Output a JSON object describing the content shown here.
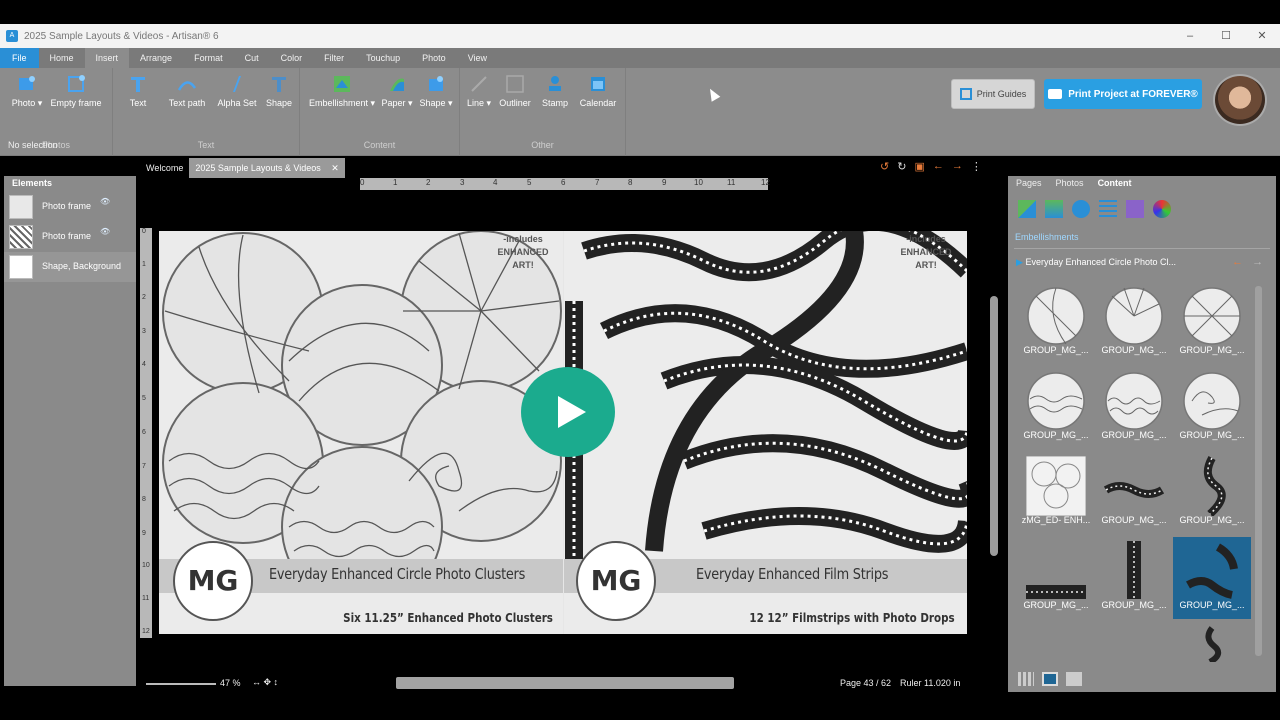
{
  "window": {
    "title": "2025 Sample Layouts & Videos - Artisan® 6",
    "app_icon": "A"
  },
  "menu": [
    "File",
    "Home",
    "Insert",
    "Arrange",
    "Format",
    "Cut",
    "Color",
    "Filter",
    "Touchup",
    "Photo",
    "View"
  ],
  "ribbon": {
    "photos": {
      "label": "Photos",
      "items": [
        "Photo ▾",
        "Empty frame"
      ]
    },
    "text": {
      "label": "Text",
      "items": [
        "Text",
        "Text path",
        "Alpha Set",
        "Shape"
      ]
    },
    "content": {
      "label": "Content",
      "items": [
        "Embellishment ▾",
        "Paper ▾",
        "Shape ▾"
      ]
    },
    "other": {
      "label": "Other",
      "items": [
        "Line ▾",
        "Outliner",
        "Stamp",
        "Calendar"
      ]
    }
  },
  "buttons": {
    "print_guides": "Print Guides",
    "print_project": "Print Project at FOREVER®"
  },
  "selection_status": "No selection",
  "elements_panel": {
    "title": "Elements",
    "items": [
      "Photo frame",
      "Photo frame",
      "Shape, Background"
    ]
  },
  "doc_tabs": {
    "welcome": "Welcome",
    "active": "2025 Sample Layouts & Videos",
    "close": "✕"
  },
  "ruler": {
    "h": [
      "0",
      "1",
      "2",
      "3",
      "4",
      "5",
      "6",
      "7",
      "8",
      "9",
      "10",
      "11",
      "12"
    ],
    "v": [
      "0",
      "1",
      "2",
      "3",
      "4",
      "5",
      "6",
      "7",
      "8",
      "9",
      "10",
      "11",
      "12"
    ]
  },
  "page_content": {
    "left_title": "Everyday Enhanced Circle Photo Clusters",
    "left_sub": "Six 11.25” Enhanced Photo Clusters",
    "right_title": "Everyday Enhanced Film Strips",
    "right_sub": "12 12” Filmstrips with Photo Drops",
    "badge": [
      "-includes",
      "ENHANCED",
      "ART!"
    ],
    "logo": "MG"
  },
  "status": {
    "zoom": "47 %",
    "page": "Page 43 / 62",
    "ruler": "Ruler 11.020 in"
  },
  "content_panel": {
    "tabs": [
      "Pages",
      "Photos",
      "Content"
    ],
    "section": "Embellishments",
    "breadcrumb": "Everyday Enhanced Circle Photo Cl...",
    "items": [
      "GROUP_MG_...",
      "GROUP_MG_...",
      "GROUP_MG_...",
      "GROUP_MG_...",
      "GROUP_MG_...",
      "GROUP_MG_...",
      "zMG_ED- ENH...",
      "GROUP_MG_...",
      "GROUP_MG_...",
      "GROUP_MG_...",
      "GROUP_MG_...",
      "GROUP_MG_..."
    ]
  },
  "colors": {
    "accent": "#2a8fd6",
    "play": "#1bab8e",
    "selected": "#1f6694",
    "orange": "#e87b3a"
  }
}
